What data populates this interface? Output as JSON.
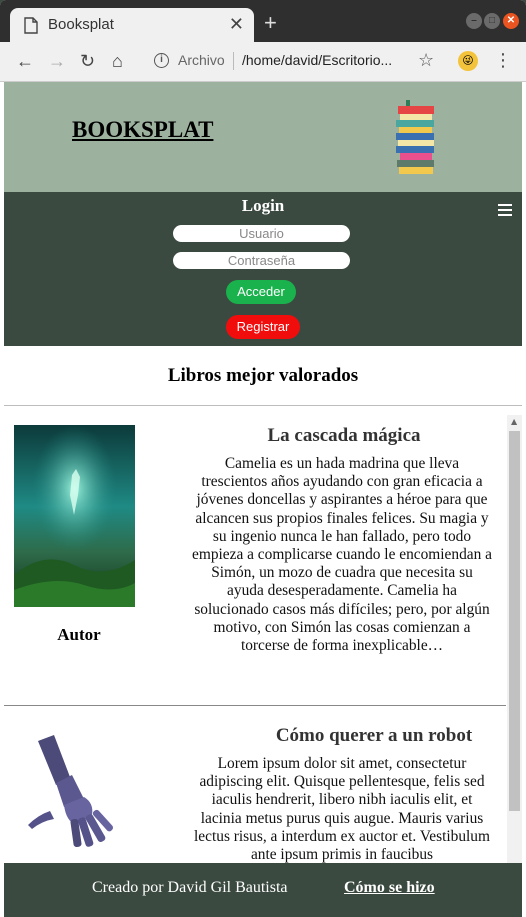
{
  "browser": {
    "tab_title": "Booksplat",
    "tab_close": "✕",
    "new_tab": "+",
    "scheme": "Archivo",
    "url": "/home/david/Escritorio...",
    "back": "←",
    "forward": "→",
    "reload": "↻",
    "home": "⌂",
    "info": "i",
    "star": "☆",
    "menu": "⋮",
    "win_min": "–",
    "win_max": "□",
    "win_close": "✕"
  },
  "header": {
    "brand": "BOOKSPLAT"
  },
  "login": {
    "title": "Login",
    "user_placeholder": "Usuario",
    "pass_placeholder": "Contraseña",
    "submit": "Acceder",
    "register": "Registrar"
  },
  "section": {
    "title": "Libros mejor valorados"
  },
  "books": [
    {
      "title": "La cascada mágica",
      "author_label": "Autor",
      "description": "Camelia es un hada madrina que lleva trescientos años ayudando con gran eficacia a jóvenes doncellas y aspirantes a héroe para que alcancen sus propios finales felices. Su magia y su ingenio nunca le han fallado, pero todo empieza a complicarse cuando le encomiendan a Simón, un mozo de cuadra que necesita su ayuda desesperadamente. Camelia ha solucionado casos más difíciles; pero, por algún motivo, con Simón las cosas comienzan a torcerse de forma inexplicable…"
    },
    {
      "title": "Cómo querer a un robot",
      "description": "Lorem ipsum dolor sit amet, consectetur adipiscing elit. Quisque pellentesque, felis sed iaculis hendrerit, libero nibh iaculis elit, et lacinia metus purus quis augue. Mauris varius lectus risus, a interdum ex auctor et. Vestibulum ante ipsum primis in faucibus"
    }
  ],
  "footer": {
    "credit": "Creado por David Gil Bautista",
    "link": "Cómo se hizo"
  },
  "colors": {
    "header_bg": "#9db19f",
    "dark_green": "#3b4a40",
    "acceder": "#1ab24d",
    "registrar": "#f20d0d"
  }
}
